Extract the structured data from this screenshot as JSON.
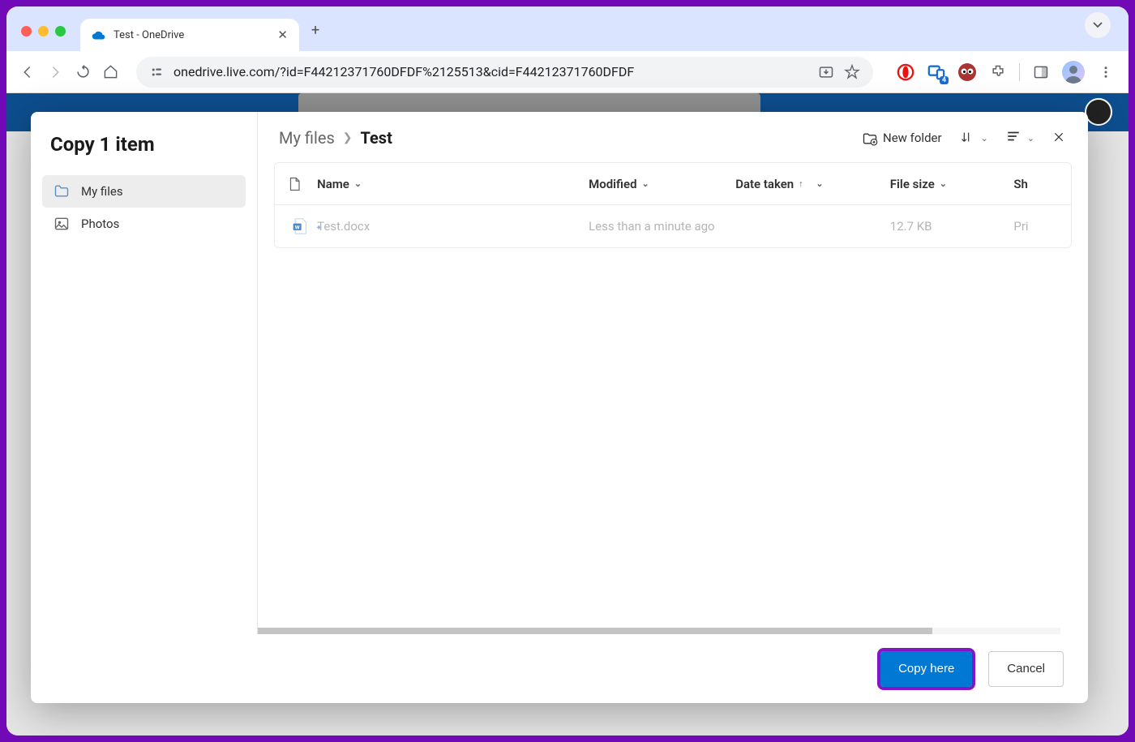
{
  "browser": {
    "tab_title": "Test - OneDrive",
    "url": "onedrive.live.com/?id=F44212371760DFDF%2125513&cid=F44212371760DFDF",
    "extension_badge": "4"
  },
  "dialog": {
    "title": "Copy 1 item",
    "sidebar": {
      "items": [
        {
          "label": "My files",
          "active": true
        },
        {
          "label": "Photos",
          "active": false
        }
      ]
    },
    "breadcrumb": {
      "root": "My files",
      "current": "Test"
    },
    "actions": {
      "new_folder": "New folder"
    },
    "table": {
      "headers": {
        "name": "Name",
        "modified": "Modified",
        "date_taken": "Date taken",
        "file_size": "File size",
        "sharing": "Sh"
      },
      "rows": [
        {
          "name": "Test.docx",
          "modified": "Less than a minute ago",
          "date_taken": "",
          "file_size": "12.7 KB",
          "sharing": "Pri"
        }
      ]
    },
    "footer": {
      "primary": "Copy here",
      "secondary": "Cancel"
    }
  }
}
